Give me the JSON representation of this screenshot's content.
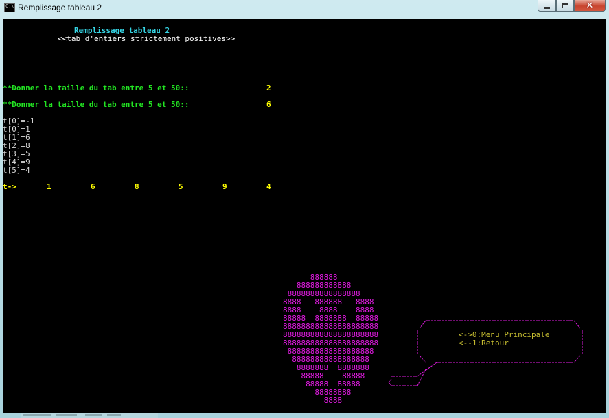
{
  "window": {
    "title": "Remplissage tableau 2",
    "icon": "console-icon"
  },
  "caption_buttons": [
    "minimize-icon",
    "maximize-icon",
    "close-icon"
  ],
  "console": {
    "heading": "Remplissage tableau 2",
    "subheading": "<<tab d'entiers strictement positives>>",
    "prompts": [
      {
        "text": "**Donner la taille du tab entre 5 et 50::",
        "value": "2"
      },
      {
        "text": "**Donner la taille du tab entre 5 et 50::",
        "value": "6"
      }
    ],
    "entries": [
      "t[0]=-1",
      "t[0]=1",
      "t[1]=6",
      "t[2]=8",
      "t[3]=5",
      "t[4]=9",
      "t[5]=4"
    ],
    "result_label": "t->",
    "result_values": [
      "1",
      "6",
      "8",
      "5",
      "9",
      "4"
    ],
    "ascii_art": [
      "      888888",
      "   888888888888",
      " 8888888888888888",
      "8888   888888   8888",
      "8888    8888    8888",
      "88888  8888888  88888",
      "888888888888888888888",
      "888888888888888888888",
      "888888888888888888888",
      " 8888888888888888888",
      "  88888888888888888",
      "   8888888  8888888",
      "    88888    88888",
      "     88888  88888",
      "       88888888",
      "         8888"
    ],
    "menu": {
      "items": [
        "<->0:Menu Principale",
        "<--1:Retour"
      ]
    }
  },
  "colors": {
    "console_bg": "#000000",
    "heading": "#36d6e6",
    "prompt": "#22e522",
    "result": "#ffff00",
    "ascii": "#e11be1",
    "menu_text": "#c4bb30"
  }
}
